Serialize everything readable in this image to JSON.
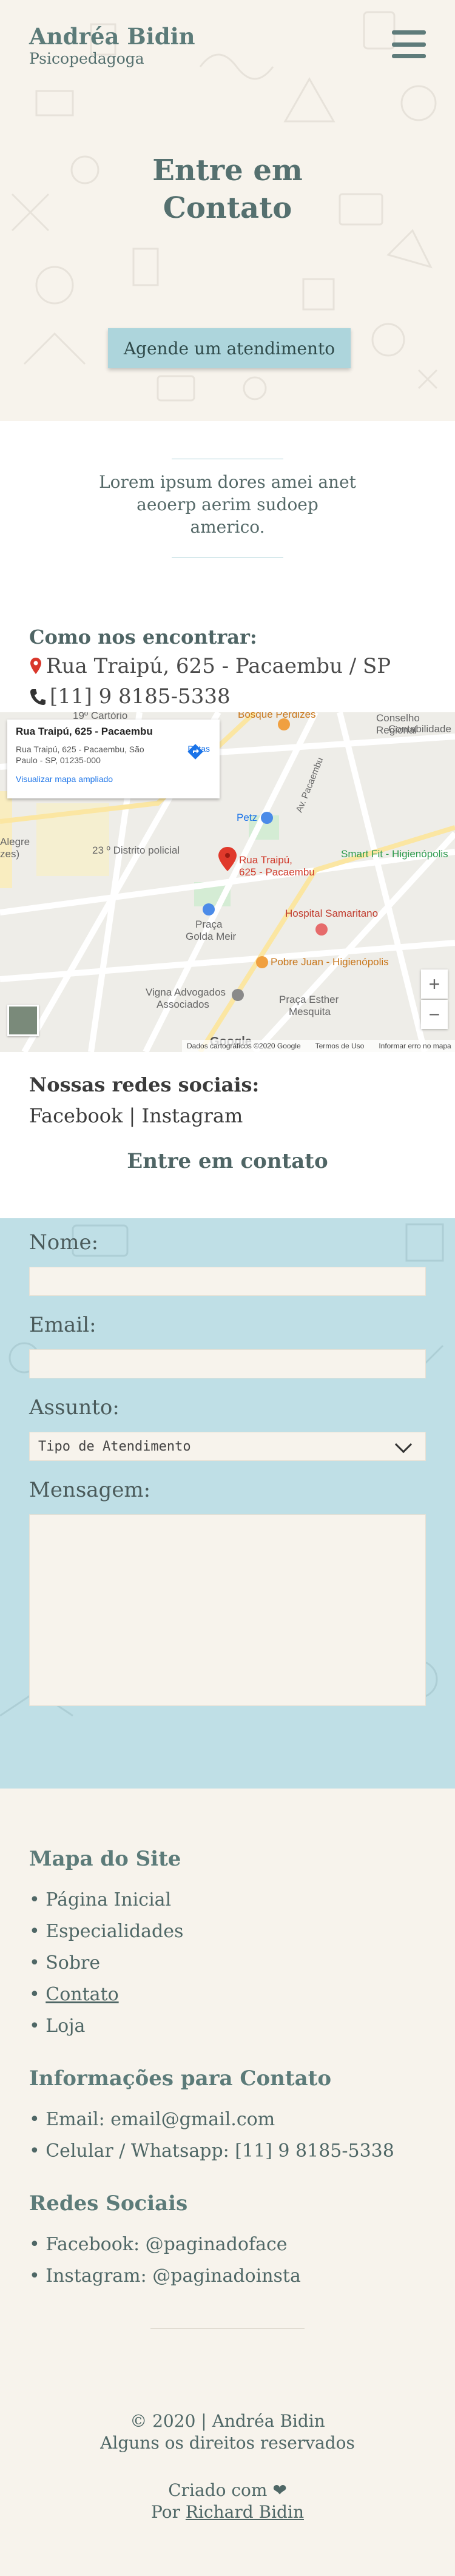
{
  "header": {
    "brand_name": "Andréa Bidin",
    "brand_subtitle": "Psicopedagoga",
    "menu_icon": "hamburger-menu-icon"
  },
  "hero": {
    "title_line1": "Entre em",
    "title_line2": "Contato",
    "cta_label": "Agende um atendimento"
  },
  "intro": {
    "text": "Lorem ipsum dores amei anet aeoerp aerim sudoep americo."
  },
  "find": {
    "heading": "Como nos encontrar:",
    "address": "Rua Traipú, 625 - Pacaembu / SP",
    "phone": "[11] 9 8185-5338",
    "pin_icon": "map-pin-icon",
    "phone_icon": "phone-icon"
  },
  "map": {
    "card_title": "Rua Traipú, 625 - Pacaembu",
    "card_address": "Rua Traipú, 625 - Pacaembu, São Paulo - SP, 01235-000",
    "card_link": "Visualizar mapa ampliado",
    "card_directions": "Rotas",
    "pin_label_line1": "Rua Traipú,",
    "pin_label_line2": "625 - Pacaembu",
    "labels": {
      "cartorio": "19º Cartório",
      "distrito": "23 º Distrito policial",
      "praca": "Praça",
      "golda": "Golda Meir",
      "hospital": "Hospital Samaritano",
      "pobre": "Pobre Juan - Higienópolis",
      "vigna": "Vigna Advogados",
      "associados": "Associados",
      "esther": "Praça Esther",
      "mesquita": "Mesquita",
      "smartfit": "Smart Fit - Higienópolis",
      "conselho": "Conselho Regional",
      "contabilidade": "Contabilidade",
      "petz": "Petz",
      "pacaembu_av": "Av. Pacaembu",
      "bosque": "Bosque Perdizes",
      "alegre": "Alegre",
      "zes": "zes)"
    },
    "zoom_in": "+",
    "zoom_out": "−",
    "google": "Google",
    "footer": [
      "Dados cartográficos ©2020 Google",
      "Termos de Uso",
      "Informar erro no mapa"
    ]
  },
  "social": {
    "heading": "Nossas redes sociais:",
    "facebook": "Facebook",
    "separator": " | ",
    "instagram": "Instagram"
  },
  "contact": {
    "heading": "Entre em contato"
  },
  "form": {
    "name_label": "Nome:",
    "email_label": "Email:",
    "subject_label": "Assunto:",
    "subject_value": "Tipo de Atendimento",
    "message_label": "Mensagem:"
  },
  "footer": {
    "sitemap_heading": "Mapa do Site",
    "sitemap_items": [
      "• Página Inicial",
      "• Especialidades",
      "• Sobre",
      "Contato",
      "• Loja"
    ],
    "contact_heading": "Informações para Contato",
    "contact_items": [
      "• Email: email@gmail.com",
      "• Celular / Whatsapp: [11] 9 8185-5338"
    ],
    "social_heading": "Redes Sociais",
    "social_items": [
      "• Facebook: @paginadoface",
      "• Instagram: @paginadoinsta"
    ],
    "copyright": "© 2020 | Andréa Bidin",
    "rights": "Alguns os direitos reservados",
    "made_with": "Criado com ❤",
    "by": "Por",
    "author": "Richard Bidin"
  },
  "colors": {
    "hero_bg": "#f7f3ec",
    "accent_teal": "#5c7b79",
    "cta_bg": "#add5dc",
    "form_bg": "#bfdfe6"
  }
}
